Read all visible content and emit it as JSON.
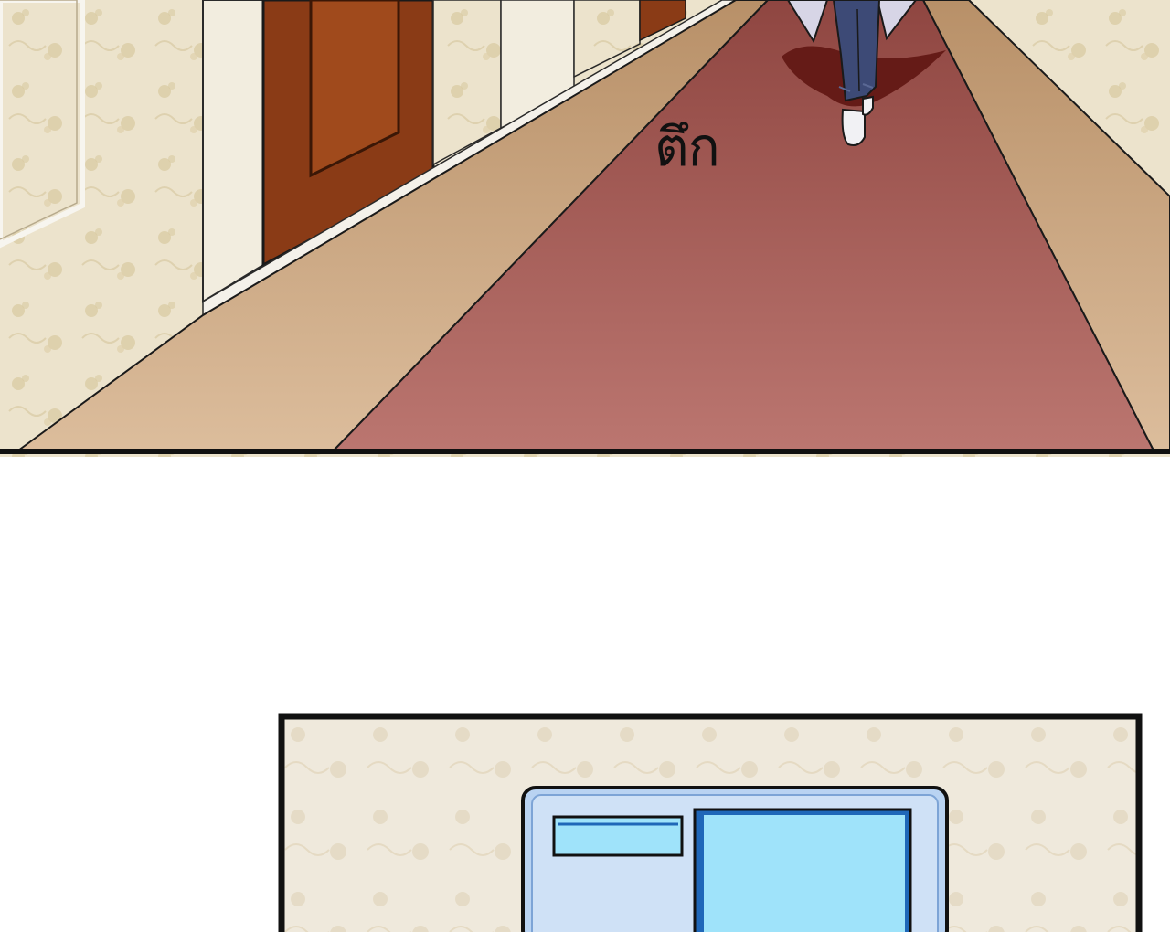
{
  "sound_effect": "ตึก",
  "colors": {
    "wall": "#ece3cc",
    "wall_pattern": "#d9c9a0",
    "baseboard": "#f4f1ea",
    "floor_side": "#cfab86",
    "carpet": "#a45a55",
    "carpet_light": "#bb7670",
    "door": "#8a3b16",
    "door_panel": "#a04a1c",
    "outline": "#111111",
    "screen_frame": "#b9d3f2",
    "screen_blue": "#9fe3fa",
    "screen_border": "#1f67b8"
  },
  "scene": {
    "top_panel": "hallway",
    "bottom_panel": "wall-device"
  }
}
